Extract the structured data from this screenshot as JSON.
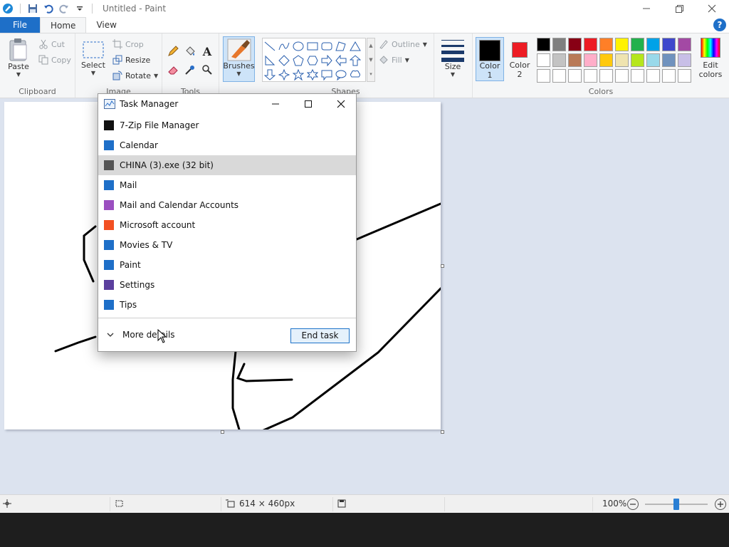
{
  "window": {
    "title": "Untitled - Paint"
  },
  "ribbon_tabs": [
    {
      "label": "File"
    },
    {
      "label": "Home"
    },
    {
      "label": "View"
    }
  ],
  "help": "?",
  "clipboard": {
    "paste": "Paste",
    "cut": "Cut",
    "copy": "Copy",
    "label": "Clipboard"
  },
  "image": {
    "select": "Select",
    "crop": "Crop",
    "resize": "Resize",
    "rotate": "Rotate",
    "label": "Image"
  },
  "tools": {
    "label": "Tools",
    "text_glyph": "A"
  },
  "brushes": {
    "label": "Brushes"
  },
  "shapes": {
    "outline": "Outline",
    "fill": "Fill",
    "label": "Shapes"
  },
  "size": {
    "label": "Size"
  },
  "colors": {
    "color1": "Color\n1",
    "color1_line1": "Color",
    "color1_line2": "1",
    "color2_line1": "Color",
    "color2_line2": "2",
    "color1_value": "#000000",
    "color2_value": "#ed1c24",
    "edit_line1": "Edit",
    "edit_line2": "colors",
    "label": "Colors",
    "palette_row1": [
      "#000000",
      "#7f7f7f",
      "#880015",
      "#ed1c24",
      "#ff7f27",
      "#fff200",
      "#22b14c",
      "#00a2e8",
      "#3f48cc",
      "#a349a4"
    ],
    "palette_row2": [
      "#ffffff",
      "#c3c3c3",
      "#b97a57",
      "#ffaec9",
      "#ffc90e",
      "#efe4b0",
      "#b5e61d",
      "#99d9ea",
      "#7092be",
      "#c8bfe7"
    ],
    "palette_row3": [
      "#ffffff",
      "#ffffff",
      "#ffffff",
      "#ffffff",
      "#ffffff",
      "#ffffff",
      "#ffffff",
      "#ffffff",
      "#ffffff",
      "#ffffff"
    ]
  },
  "task_manager": {
    "title": "Task Manager",
    "apps": [
      {
        "name": "7-Zip File Manager",
        "icon": "7zip-icon",
        "color": "#111111"
      },
      {
        "name": "Calendar",
        "icon": "calendar-icon",
        "color": "#1e6fc8"
      },
      {
        "name": "CHINA (3).exe (32 bit)",
        "icon": "exe-window-icon",
        "color": "#555555"
      },
      {
        "name": "Mail",
        "icon": "mail-icon",
        "color": "#1e6fc8"
      },
      {
        "name": "Mail and Calendar Accounts",
        "icon": "gear-icon",
        "color": "#9b4fc0"
      },
      {
        "name": "Microsoft account",
        "icon": "microsoft-logo-icon",
        "color": "#f25022"
      },
      {
        "name": "Movies & TV",
        "icon": "movies-icon",
        "color": "#1e6fc8"
      },
      {
        "name": "Paint",
        "icon": "paint-icon",
        "color": "#1e6fc8"
      },
      {
        "name": "Settings",
        "icon": "settings-icon",
        "color": "#5b3f9e"
      },
      {
        "name": "Tips",
        "icon": "tips-icon",
        "color": "#1e6fc8"
      }
    ],
    "selected_index": 2,
    "more_details": "More details",
    "end_task": "End task"
  },
  "status": {
    "dimensions": "614 × 460px",
    "zoom": "100%"
  }
}
